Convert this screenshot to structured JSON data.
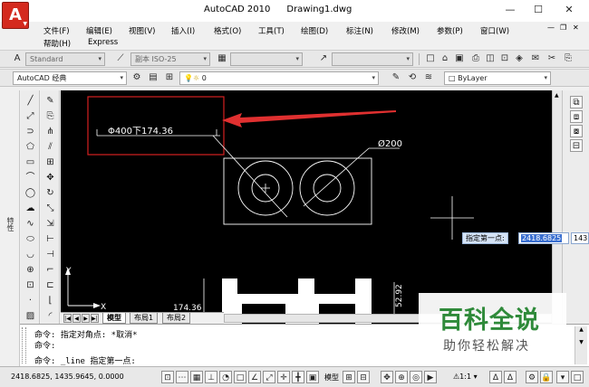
{
  "app": {
    "logo_letter": "A",
    "title": "AutoCAD 2010",
    "document": "Drawing1.dwg"
  },
  "menu": {
    "row1": [
      "文件(F)",
      "编辑(E)",
      "视图(V)",
      "插入(I)",
      "格式(O)",
      "工具(T)",
      "绘图(D)",
      "标注(N)",
      "修改(M)",
      "参数(P)",
      "窗口(W)"
    ],
    "row2": [
      "帮助(H)",
      "Express"
    ]
  },
  "toolbar_styles": {
    "text_style": "Standard",
    "dim_style": "副本 ISO-25"
  },
  "toolbar_layers": {
    "workspace": "AutoCAD 经典",
    "layer_name": "0",
    "color": "ByLayer"
  },
  "side_panel": {
    "label": "特性"
  },
  "drawing": {
    "label_left": "Φ400下174.36",
    "label_right": "Ø200",
    "dim_bottom": "174.36",
    "dim_right": "52.92",
    "colors": {
      "highlight_box": "#d42020",
      "arrow": "#e03030",
      "lines": "#ffffff"
    }
  },
  "tabs": {
    "model": "模型",
    "layout1": "布局1",
    "layout2": "布局2"
  },
  "dynamic_input": {
    "prompt": "指定第一点:",
    "x_value": "2418.6825",
    "y_value": "143"
  },
  "command_line": {
    "line1": "命令: 指定对角点: *取消*",
    "line2": "命令:",
    "line3": "命令: _line 指定第一点:"
  },
  "status": {
    "coords": "2418.6825, 1435.9645, 0.0000",
    "model_label": "模型",
    "scale": "1:1"
  },
  "watermark": {
    "title": "百科全说",
    "subtitle": "助你轻松解决"
  }
}
